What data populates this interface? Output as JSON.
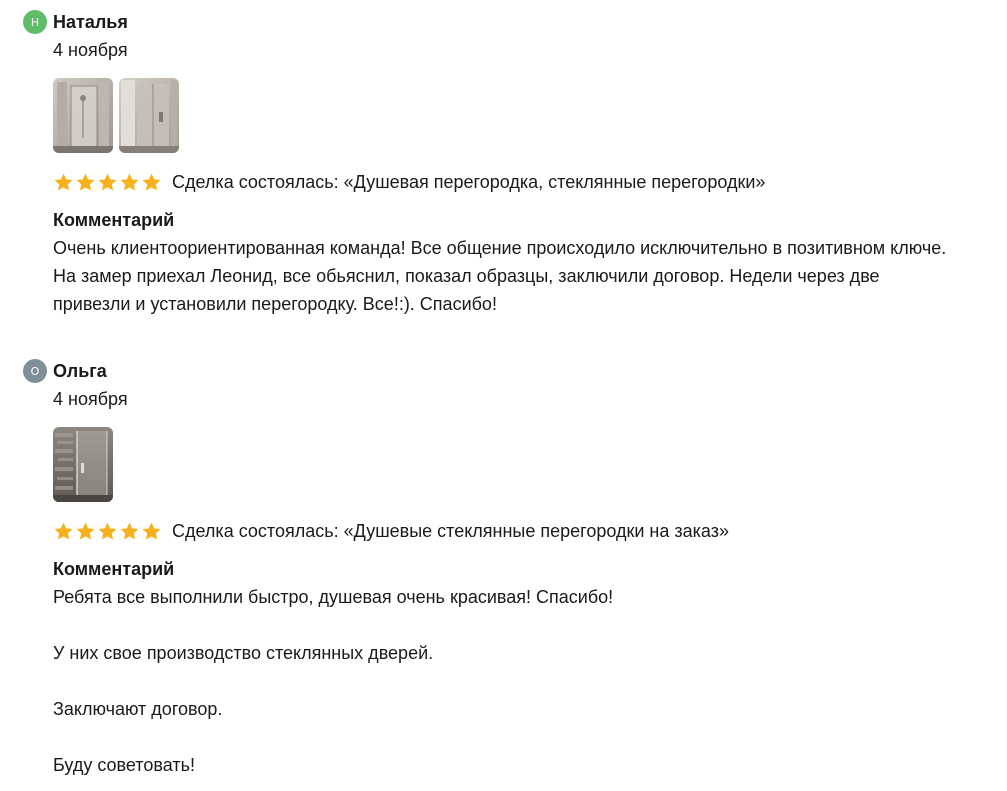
{
  "reviews": [
    {
      "author": "Наталья",
      "avatar_letter": "Н",
      "avatar_color": "#5fbd6a",
      "date": "4 ноября",
      "photos": [
        {
          "name": "shower-partition-photo-1"
        },
        {
          "name": "shower-partition-photo-2"
        }
      ],
      "rating": 5,
      "deal": "Сделка состоялась: «Душевая перегородка, стеклянные перегородки»",
      "comment_title": "Комментарий",
      "comment": [
        "Очень клиентоориентированная команда! Все общение происходило исключительно в позитивном ключе. На замер приехал Леонид, все обьяснил, показал образцы, заключили договор. Недели через две привезли и установили перегородку. Все!:). Спасибо!"
      ]
    },
    {
      "author": "Ольга",
      "avatar_letter": "О",
      "avatar_color": "#7f8f9a",
      "date": "4 ноября",
      "photos": [
        {
          "name": "glass-shower-door-photo"
        }
      ],
      "rating": 5,
      "deal": "Сделка состоялась: «Душевые стеклянные перегородки на заказ»",
      "comment_title": "Комментарий",
      "comment": [
        "Ребята все выполнили быстро, душевая очень красивая! Спасибо!",
        "У них свое производство стеклянных дверей.",
        "Заключают договор.",
        "Буду советовать!"
      ]
    }
  ],
  "star_color": "#f7b21b"
}
